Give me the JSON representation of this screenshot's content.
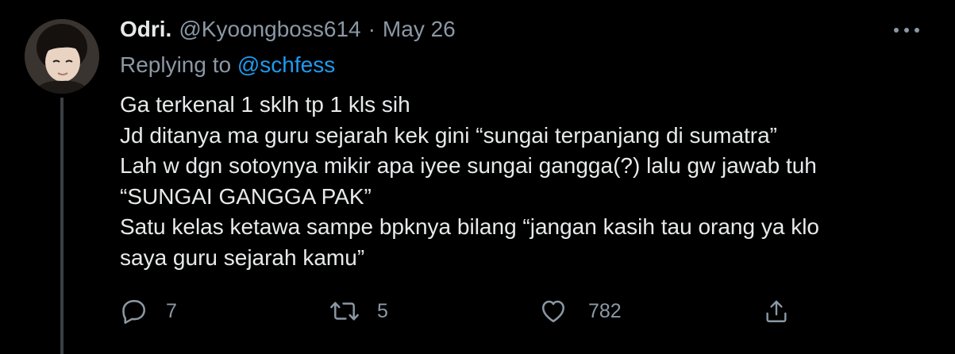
{
  "tweet": {
    "author": {
      "display_name": "Odri.",
      "handle": "@Kyoongboss614",
      "separator": "·",
      "date": "May 26"
    },
    "reply": {
      "prefix": "Replying to",
      "target": "@schfess"
    },
    "body_lines": [
      "Ga terkenal 1 sklh tp 1 kls sih",
      "Jd ditanya ma guru sejarah kek gini “sungai terpanjang di sumatra”",
      "Lah w dgn sotoynya mikir apa iyee sungai gangga(?) lalu gw jawab tuh",
      "“SUNGAI GANGGA PAK”",
      "Satu kelas ketawa sampe bpknya bilang “jangan kasih tau orang ya klo",
      "saya guru sejarah kamu”"
    ],
    "actions": {
      "reply_count": "7",
      "retweet_count": "5",
      "like_count": "782"
    }
  },
  "icons": {
    "avatar": "avatar",
    "more": "more-horizontal-icon",
    "reply": "reply-bubble-icon",
    "retweet": "retweet-icon",
    "like": "heart-icon",
    "share": "share-icon"
  },
  "colors": {
    "background": "#000000",
    "primary_text": "#e7e9ea",
    "secondary_text": "#8b98a5",
    "link": "#1d9bf0",
    "thread_line": "#3b3f43"
  }
}
